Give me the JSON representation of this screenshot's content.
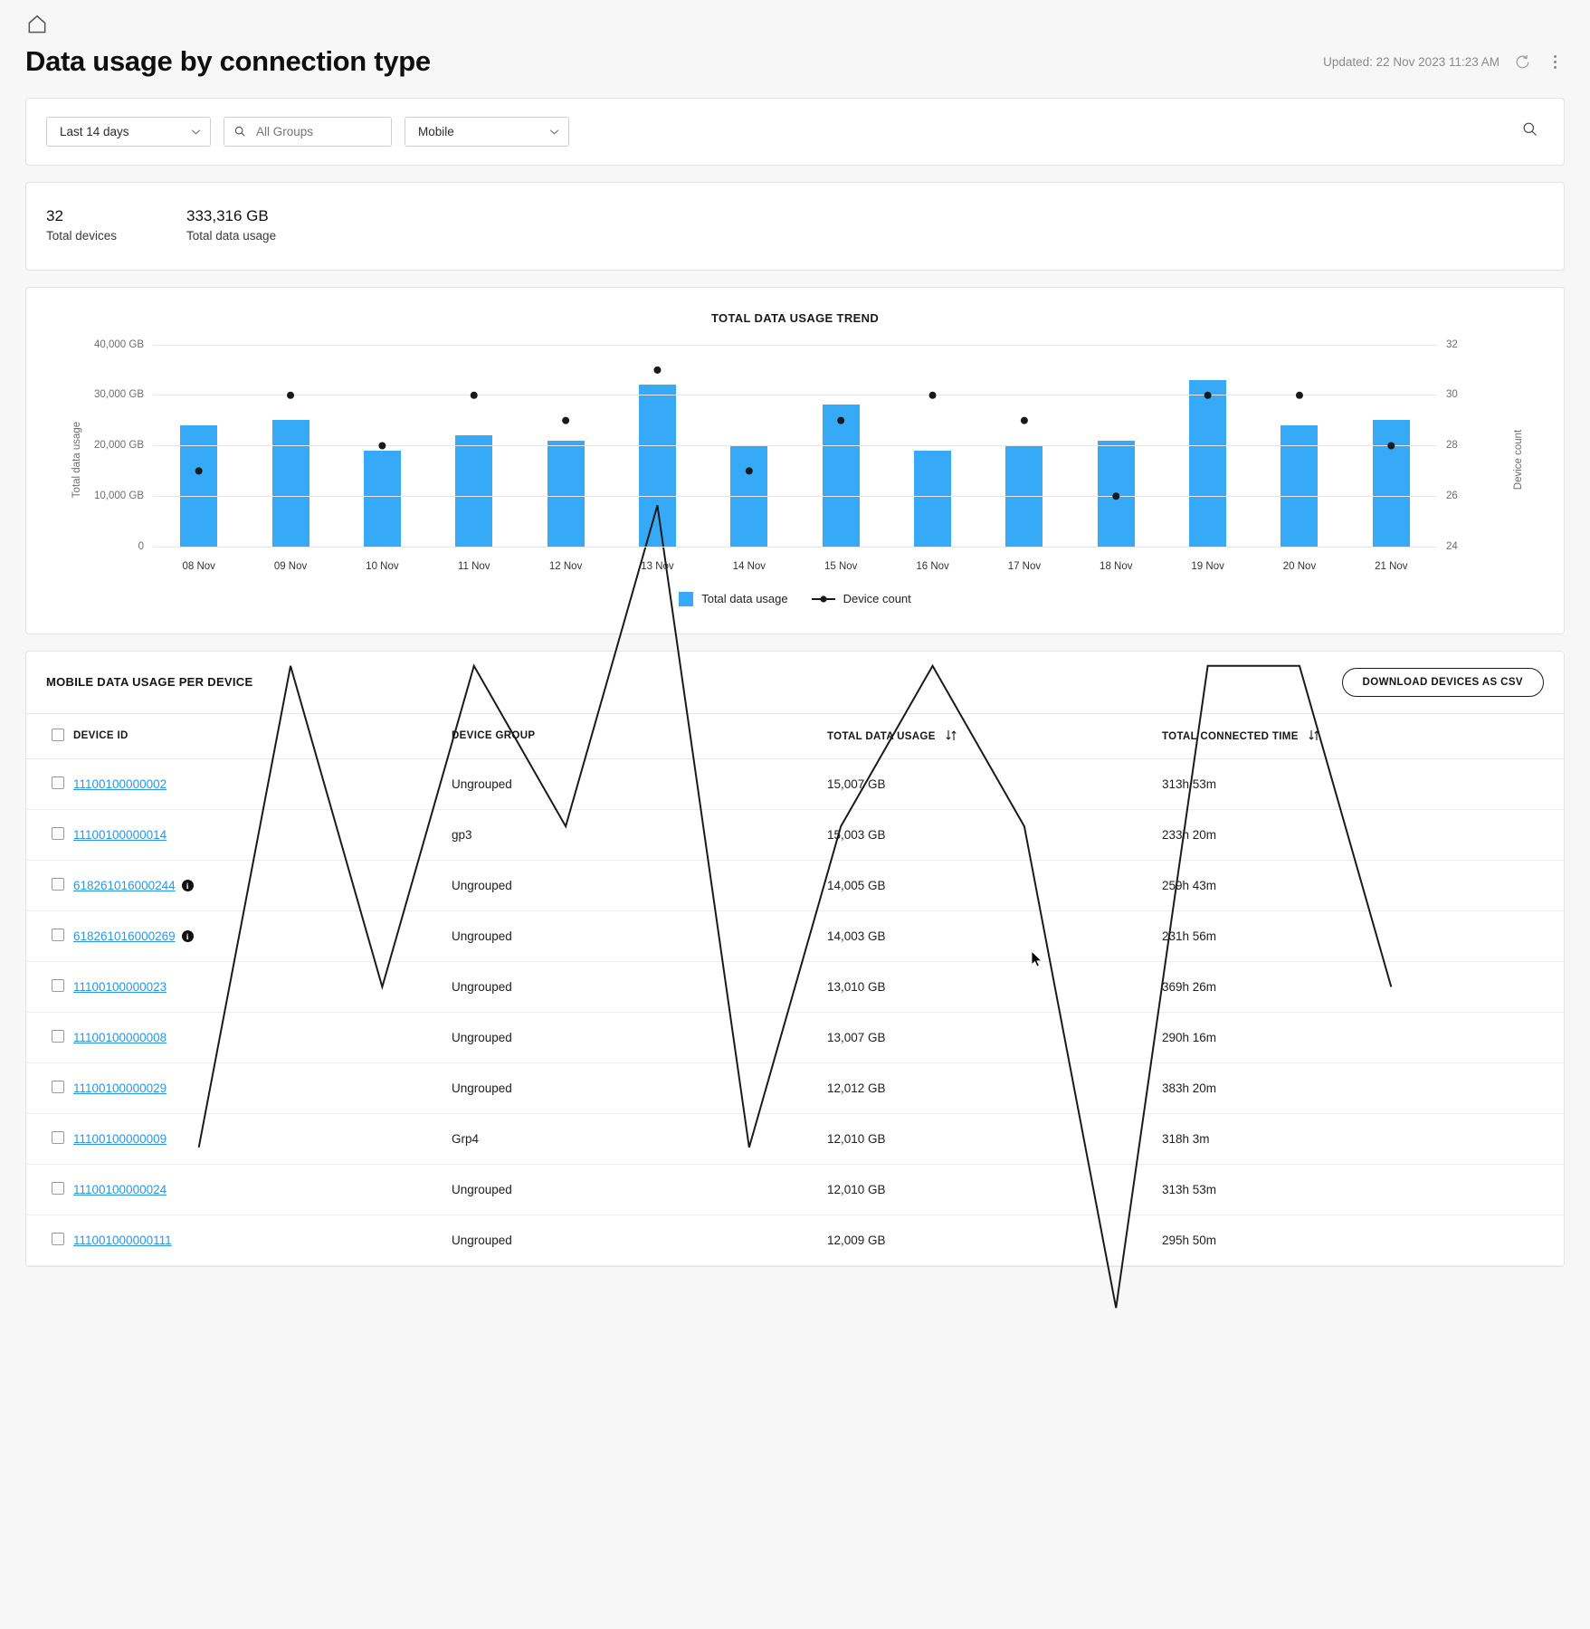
{
  "header": {
    "home_icon": "home-icon",
    "title": "Data usage by connection type",
    "updated": "Updated: 22 Nov 2023 11:23 AM",
    "refresh_icon": "refresh-icon",
    "more_icon": "kebab-menu-icon"
  },
  "filters": {
    "date_range": "Last 14 days",
    "group_placeholder": "All Groups",
    "group_value": "",
    "connection_type": "Mobile",
    "search_icon": "search-icon"
  },
  "summary": {
    "devices_value": "32",
    "devices_label": "Total devices",
    "usage_value": "333,316 GB",
    "usage_label": "Total data usage"
  },
  "chart_data": {
    "type": "bar",
    "title": "TOTAL DATA USAGE TREND",
    "xlabel": "",
    "ylabel": "Total data usage",
    "y2label": "Device count",
    "categories": [
      "08 Nov",
      "09 Nov",
      "10 Nov",
      "11 Nov",
      "12 Nov",
      "13 Nov",
      "14 Nov",
      "15 Nov",
      "16 Nov",
      "17 Nov",
      "18 Nov",
      "19 Nov",
      "20 Nov",
      "21 Nov"
    ],
    "series": [
      {
        "name": "Total data usage",
        "type": "bar",
        "axis": "left",
        "color": "#36aaf7",
        "values": [
          24000,
          25000,
          19000,
          22000,
          21000,
          32000,
          20000,
          28000,
          19000,
          20000,
          21000,
          33000,
          24000,
          25000
        ]
      },
      {
        "name": "Device count",
        "type": "line",
        "axis": "right",
        "color": "#1a1a1a",
        "values": [
          27,
          30,
          28,
          30,
          29,
          31,
          27,
          29,
          30,
          29,
          26,
          30,
          30,
          28
        ]
      }
    ],
    "yticks": [
      "0",
      "10,000 GB",
      "20,000 GB",
      "30,000 GB",
      "40,000 GB"
    ],
    "ylim": [
      0,
      40000
    ],
    "y2ticks": [
      "24",
      "26",
      "28",
      "30",
      "32"
    ],
    "y2lim": [
      24,
      32
    ],
    "grid": true,
    "legend_position": "bottom",
    "legend": [
      "Total data usage",
      "Device count"
    ]
  },
  "table": {
    "title": "MOBILE DATA USAGE PER DEVICE",
    "download_label": "DOWNLOAD DEVICES AS CSV",
    "columns": [
      "DEVICE ID",
      "DEVICE GROUP",
      "TOTAL DATA USAGE",
      "TOTAL CONNECTED TIME"
    ],
    "rows": [
      {
        "id": "11100100000002",
        "info": false,
        "group": "Ungrouped",
        "usage": "15,007 GB",
        "time": "313h 53m"
      },
      {
        "id": "11100100000014",
        "info": false,
        "group": "gp3",
        "usage": "15,003 GB",
        "time": "233h 20m"
      },
      {
        "id": "618261016000244",
        "info": true,
        "group": "Ungrouped",
        "usage": "14,005 GB",
        "time": "259h 43m"
      },
      {
        "id": "618261016000269",
        "info": true,
        "group": "Ungrouped",
        "usage": "14,003 GB",
        "time": "231h 56m"
      },
      {
        "id": "11100100000023",
        "info": false,
        "group": "Ungrouped",
        "usage": "13,010 GB",
        "time": "369h 26m"
      },
      {
        "id": "11100100000008",
        "info": false,
        "group": "Ungrouped",
        "usage": "13,007 GB",
        "time": "290h 16m"
      },
      {
        "id": "11100100000029",
        "info": false,
        "group": "Ungrouped",
        "usage": "12,012 GB",
        "time": "383h 20m"
      },
      {
        "id": "11100100000009",
        "info": false,
        "group": "Grp4",
        "usage": "12,010 GB",
        "time": "318h 3m"
      },
      {
        "id": "11100100000024",
        "info": false,
        "group": "Ungrouped",
        "usage": "12,010 GB",
        "time": "313h 53m"
      },
      {
        "id": "111001000000111",
        "info": false,
        "group": "Ungrouped",
        "usage": "12,009 GB",
        "time": "295h 50m"
      }
    ]
  }
}
